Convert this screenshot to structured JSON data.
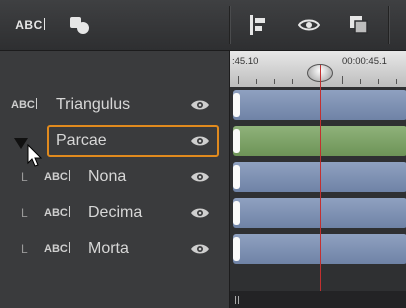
{
  "toolbar": {
    "abc_label": "ABC",
    "items": [
      {
        "name": "title-tool",
        "icon": "abc-text-icon"
      },
      {
        "name": "shape-tool",
        "icon": "shapes-icon"
      },
      {
        "name": "align-left",
        "icon": "align-left-icon"
      },
      {
        "name": "view-toggle",
        "icon": "eye-icon"
      },
      {
        "name": "arrange",
        "icon": "layers-icon"
      }
    ]
  },
  "ruler": {
    "left_time": ":45.10",
    "right_time": "00:00:45.1"
  },
  "tracks": [
    {
      "label": "Triangulus",
      "indent": 0,
      "badge": "ABC",
      "visible": true,
      "selected": false
    },
    {
      "label": "Parcae",
      "indent": 0,
      "badge": "",
      "visible": true,
      "selected": true
    },
    {
      "label": "Nona",
      "indent": 1,
      "badge": "ABC",
      "visible": true,
      "selected": false
    },
    {
      "label": "Decima",
      "indent": 1,
      "badge": "ABC",
      "visible": true,
      "selected": false
    },
    {
      "label": "Morta",
      "indent": 1,
      "badge": "ABC",
      "visible": true,
      "selected": false
    }
  ],
  "tree_marker": "L",
  "colors": {
    "selection": "#e08a1e",
    "playhead": "#c23030",
    "clip_blue": "#7e91b3",
    "clip_green": "#7ea367"
  }
}
